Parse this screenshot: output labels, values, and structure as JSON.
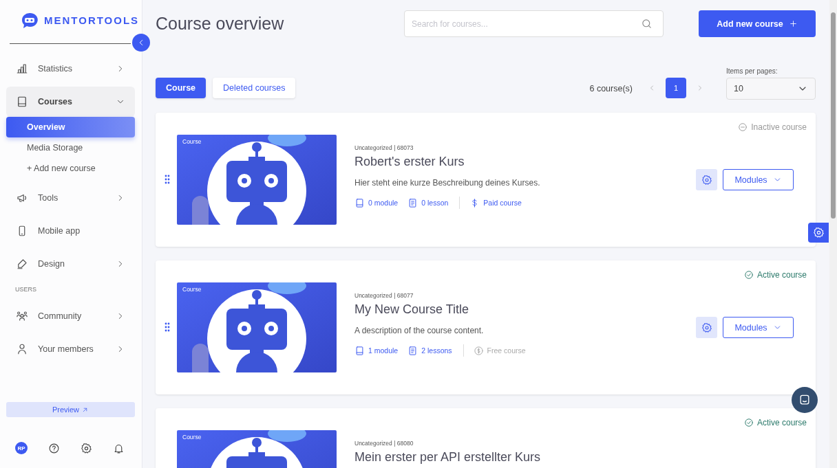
{
  "logo": {
    "text": "MENTORTOOLS"
  },
  "sidebar": {
    "groups": [
      {
        "items": [
          {
            "label": "Statistics",
            "kind": "collapsible",
            "expanded": false
          },
          {
            "label": "Courses",
            "kind": "collapsible",
            "expanded": true,
            "children": [
              {
                "label": "Overview",
                "selected": true
              },
              {
                "label": "Media Storage",
                "selected": false
              },
              {
                "label": "+ Add new course",
                "selected": false
              }
            ]
          },
          {
            "label": "Tools",
            "kind": "collapsible",
            "expanded": false
          },
          {
            "label": "Mobile app",
            "kind": "link"
          },
          {
            "label": "Design",
            "kind": "collapsible",
            "expanded": false
          }
        ]
      },
      {
        "heading": "USERS",
        "items": [
          {
            "label": "Community",
            "kind": "collapsible",
            "expanded": false
          },
          {
            "label": "Your members",
            "kind": "collapsible",
            "expanded": false
          }
        ]
      }
    ],
    "preview": "Preview",
    "avatar": "RP"
  },
  "header": {
    "title": "Course overview",
    "search": {
      "placeholder": "Search for courses..."
    },
    "add_button": "Add new course"
  },
  "tabs": [
    {
      "label": "Course",
      "selected": true
    },
    {
      "label": "Deleted courses",
      "selected": false
    }
  ],
  "pagination": {
    "count": "6 course(s)",
    "pages": [
      {
        "label": "1",
        "selected": true
      }
    ],
    "per_page_label": "Items per pages:",
    "per_page": "10"
  },
  "courses": [
    {
      "thumb_label": "Course",
      "meta": "Uncategorized | 68073",
      "title": "Robert's erster Kurs",
      "description": "Hier steht eine kurze Beschreibung deines Kurses.",
      "modules": "0 module",
      "lessons": "0 lesson",
      "price": {
        "kind": "paid",
        "label": "Paid course"
      },
      "status": {
        "kind": "inactive",
        "label": "Inactive course"
      },
      "action": "Modules"
    },
    {
      "thumb_label": "Course",
      "meta": "Uncategorized | 68077",
      "title": "My New Course Title",
      "description": "A description of the course content.",
      "modules": "1 module",
      "lessons": "2 lessons",
      "price": {
        "kind": "free",
        "label": "Free course"
      },
      "status": {
        "kind": "active",
        "label": "Active course"
      },
      "action": "Modules"
    },
    {
      "thumb_label": "Course",
      "meta": "Uncategorized | 68080",
      "title": "Mein erster per API erstellter Kurs",
      "status": {
        "kind": "active",
        "label": "Active course"
      }
    }
  ]
}
